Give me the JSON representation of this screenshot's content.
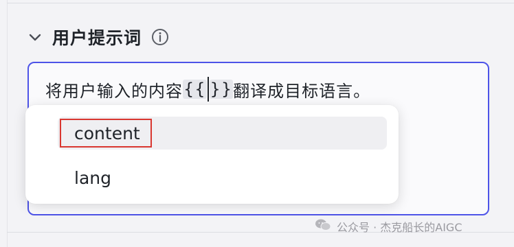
{
  "section": {
    "title": "用户提示词",
    "chevron_icon": "chevron-down-icon",
    "info_icon": "info-circle-icon"
  },
  "editor": {
    "text_before": "将用户输入的内容",
    "brace_open": "{{",
    "brace_close": "}}",
    "text_after": "翻译成目标语言。",
    "border_color": "#4d53e8"
  },
  "variable_menu": {
    "options": [
      {
        "label": "content",
        "selected": true
      },
      {
        "label": "lang",
        "selected": false
      }
    ],
    "highlight_color": "#d9362f"
  },
  "watermark": {
    "text": "公众号 · 杰克船长的AIGC",
    "icon": "wechat-icon"
  }
}
